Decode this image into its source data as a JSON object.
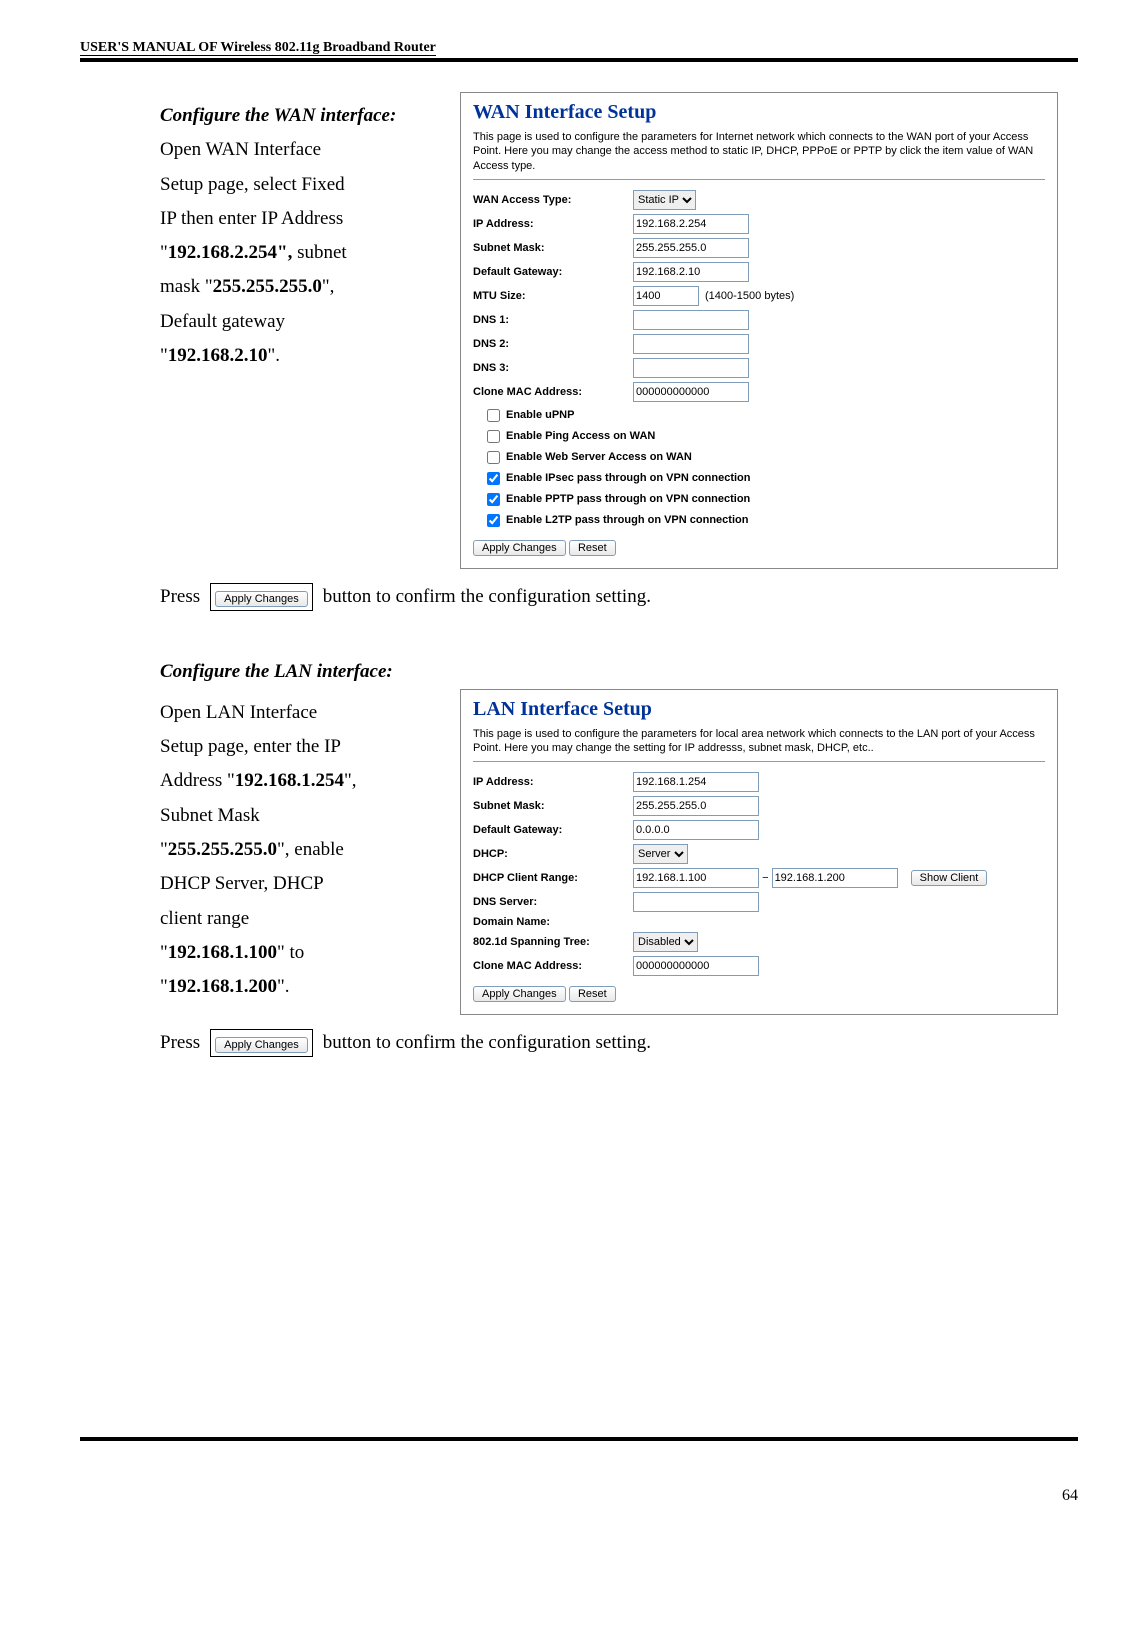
{
  "header": "USER'S MANUAL OF Wireless 802.11g Broadband Router",
  "wan_section": {
    "heading": "Configure the WAN interface:",
    "body": [
      "Open WAN Interface",
      "Setup page, select Fixed",
      "IP then enter IP Address",
      "\"192.168.2.254\", subnet",
      "mask \"255.255.255.0\",",
      "Default gateway",
      "\"192.168.2.10\"."
    ],
    "panel": {
      "title": "WAN Interface Setup",
      "desc": "This page is used to configure the parameters for Internet network which connects to the WAN port of your Access Point. Here you may change the access method to static IP, DHCP, PPPoE or PPTP by click the item value of WAN Access type.",
      "fields": {
        "access_type_label": "WAN Access Type:",
        "access_type_value": "Static IP",
        "ip_label": "IP Address:",
        "ip_value": "192.168.2.254",
        "subnet_label": "Subnet Mask:",
        "subnet_value": "255.255.255.0",
        "gw_label": "Default Gateway:",
        "gw_value": "192.168.2.10",
        "mtu_label": "MTU Size:",
        "mtu_value": "1400",
        "mtu_hint": "(1400-1500 bytes)",
        "dns1_label": "DNS 1:",
        "dns2_label": "DNS 2:",
        "dns3_label": "DNS 3:",
        "clone_label": "Clone MAC Address:",
        "clone_value": "000000000000",
        "cb_upnp": "Enable uPNP",
        "cb_ping": "Enable Ping Access on WAN",
        "cb_web": "Enable Web Server Access on WAN",
        "cb_ipsec": "Enable IPsec pass through on VPN connection",
        "cb_pptp": "Enable PPTP pass through on VPN connection",
        "cb_l2tp": "Enable L2TP pass through on VPN connection",
        "apply": "Apply Changes",
        "reset": "Reset"
      }
    },
    "press_line": {
      "press": "Press",
      "btn": "Apply Changes",
      "rest": "button to confirm the configuration setting."
    }
  },
  "lan_section": {
    "heading": "Configure the LAN interface:",
    "body": [
      "Open LAN Interface",
      "Setup page, enter the IP",
      "Address \"192.168.1.254\",",
      "Subnet Mask",
      "\"255.255.255.0\", enable",
      "DHCP Server, DHCP",
      "client range",
      "\"192.168.1.100\" to",
      "\"192.168.1.200\"."
    ],
    "panel": {
      "title": "LAN Interface Setup",
      "desc": "This page is used to configure the parameters for local area network which connects to the LAN port of your Access Point. Here you may change the setting for IP addresss, subnet mask, DHCP, etc..",
      "fields": {
        "ip_label": "IP Address:",
        "ip_value": "192.168.1.254",
        "subnet_label": "Subnet Mask:",
        "subnet_value": "255.255.255.0",
        "gw_label": "Default Gateway:",
        "gw_value": "0.0.0.0",
        "dhcp_label": "DHCP:",
        "dhcp_value": "Server",
        "range_label": "DHCP Client Range:",
        "range_from": "192.168.1.100",
        "range_dash": "−",
        "range_to": "192.168.1.200",
        "show_client": "Show Client",
        "dns_label": "DNS Server:",
        "domain_label": "Domain Name:",
        "spanning_label": "802.1d Spanning Tree:",
        "spanning_value": "Disabled",
        "clone_label": "Clone MAC Address:",
        "clone_value": "000000000000",
        "apply": "Apply Changes",
        "reset": "Reset"
      }
    },
    "press_line": {
      "press": "Press",
      "btn": "Apply Changes",
      "rest": "button to confirm the configuration setting."
    }
  },
  "page_number": "64"
}
